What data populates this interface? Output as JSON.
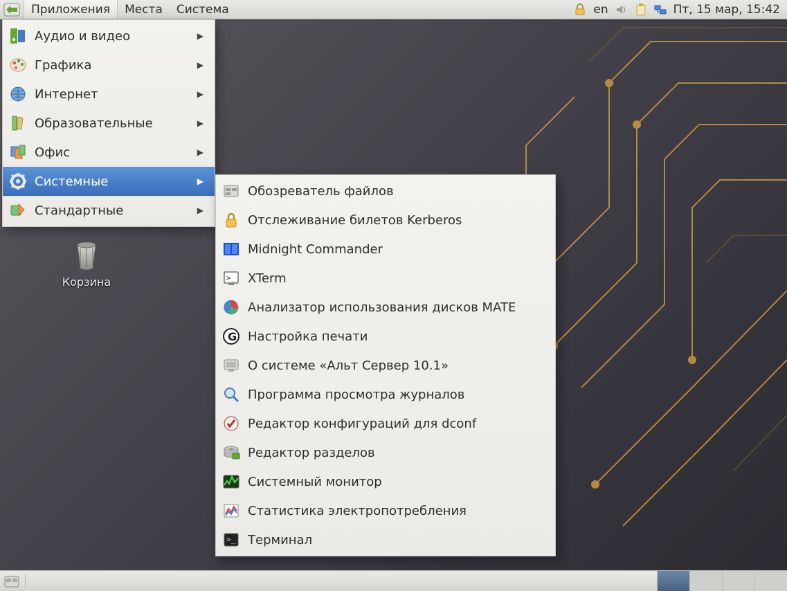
{
  "panel": {
    "menus": {
      "applications": "Приложения",
      "places": "Места",
      "system": "Система"
    },
    "tray": {
      "kb_layout": "en",
      "clock": "Пт, 15 мар, 15:42"
    }
  },
  "desktop": {
    "trash_label": "Корзина"
  },
  "app_menu": {
    "items": [
      {
        "label": "Аудио и видео",
        "icon": "audio-video"
      },
      {
        "label": "Графика",
        "icon": "graphics"
      },
      {
        "label": "Интернет",
        "icon": "internet"
      },
      {
        "label": "Образовательные",
        "icon": "education"
      },
      {
        "label": "Офис",
        "icon": "office"
      },
      {
        "label": "Системные",
        "icon": "system-gear",
        "selected": true
      },
      {
        "label": "Стандартные",
        "icon": "accessories"
      }
    ]
  },
  "submenu": {
    "items": [
      {
        "label": "Обозреватель файлов",
        "icon": "file-manager"
      },
      {
        "label": "Отслеживание билетов Kerberos",
        "icon": "lock"
      },
      {
        "label": "Midnight Commander",
        "icon": "mc"
      },
      {
        "label": "XTerm",
        "icon": "xterm"
      },
      {
        "label": "Анализатор использования дисков MATE",
        "icon": "disk-usage"
      },
      {
        "label": "Настройка печати",
        "icon": "print-settings"
      },
      {
        "label": "О системе «Альт Сервер 10.1»",
        "icon": "about-system"
      },
      {
        "label": "Программа просмотра журналов",
        "icon": "log-viewer"
      },
      {
        "label": "Редактор конфигураций для dconf",
        "icon": "dconf"
      },
      {
        "label": "Редактор разделов",
        "icon": "disk-parted"
      },
      {
        "label": "Системный монитор",
        "icon": "system-monitor"
      },
      {
        "label": "Статистика электропотребления",
        "icon": "power-stats"
      },
      {
        "label": "Терминал",
        "icon": "terminal"
      }
    ]
  }
}
